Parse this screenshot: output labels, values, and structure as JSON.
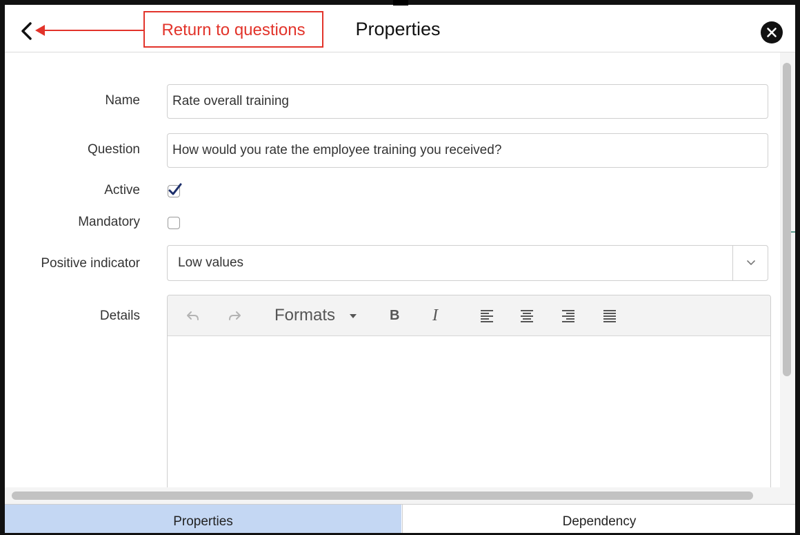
{
  "header": {
    "title": "Properties",
    "annotation": "Return to questions",
    "back_icon": "chevron-left-icon",
    "close_icon": "close-icon"
  },
  "form": {
    "name_label": "Name",
    "name_value": "Rate overall training",
    "question_label": "Question",
    "question_value": "How would you rate the employee training you received?",
    "active_label": "Active",
    "active_checked": true,
    "mandatory_label": "Mandatory",
    "mandatory_checked": false,
    "positive_indicator_label": "Positive indicator",
    "positive_indicator_value": "Low values",
    "details_label": "Details"
  },
  "editor_toolbar": {
    "undo_icon": "undo-icon",
    "redo_icon": "redo-icon",
    "formats_label": "Formats",
    "bold_label": "B",
    "italic_label": "I",
    "align_icons": [
      "align-left-icon",
      "align-center-icon",
      "align-right-icon",
      "align-justify-icon"
    ]
  },
  "tabs": [
    {
      "label": "Properties",
      "active": true
    },
    {
      "label": "Dependency",
      "active": false
    }
  ],
  "colors": {
    "annotation": "#e2332a",
    "active_tab": "#c4d7f3",
    "checkbox_check": "#1d2f6b"
  }
}
